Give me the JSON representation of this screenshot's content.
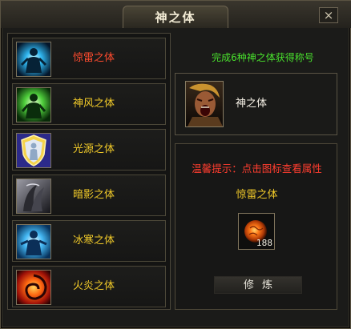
{
  "window": {
    "title": "神之体",
    "close_label": "×"
  },
  "bodies": [
    {
      "label": "惊雷之体",
      "icon": "thunder-body-icon",
      "color": "#ff4b2e",
      "selected": true
    },
    {
      "label": "神风之体",
      "icon": "wind-body-icon",
      "color": "#f1ca29",
      "selected": false
    },
    {
      "label": "光源之体",
      "icon": "light-body-icon",
      "color": "#f1ca29",
      "selected": false
    },
    {
      "label": "暗影之体",
      "icon": "shadow-body-icon",
      "color": "#f1ca29",
      "selected": false
    },
    {
      "label": "冰寒之体",
      "icon": "ice-body-icon",
      "color": "#f1ca29",
      "selected": false
    },
    {
      "label": "火炎之体",
      "icon": "fire-body-icon",
      "color": "#f1ca29",
      "selected": false
    }
  ],
  "reward": {
    "progress_text": "完成6种神之体获得称号",
    "title_name": "神之体",
    "title_icon": "roaring-warrior-icon"
  },
  "detail": {
    "hint": "温馨提示：点击图标查看属性",
    "selected_name": "惊雷之体",
    "item_icon": "fire-stone-icon",
    "item_count": "188",
    "cultivate_label": "修炼"
  }
}
